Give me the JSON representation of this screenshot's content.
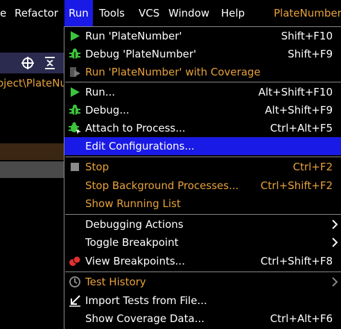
{
  "menubar": {
    "items": [
      {
        "label": "e",
        "active": false
      },
      {
        "label": "Refactor",
        "active": false
      },
      {
        "label": "Run",
        "active": true
      },
      {
        "label": "Tools",
        "active": false
      },
      {
        "label": "VCS",
        "active": false
      },
      {
        "label": "Window",
        "active": false
      },
      {
        "label": "Help",
        "active": false
      }
    ],
    "project_title": "PlateNumber"
  },
  "background": {
    "path_text": "oject\\PlateNu",
    "toolbar_icons": [
      "crosshair-icon",
      "collapse-all-icon"
    ]
  },
  "run_menu": {
    "items": [
      {
        "label": "Run 'PlateNumber'",
        "shortcut": "Shift+F10",
        "icon": "run-icon"
      },
      {
        "label": "Debug 'PlateNumber'",
        "shortcut": "Shift+F9",
        "icon": "debug-icon"
      },
      {
        "label": "Run 'PlateNumber' with Coverage",
        "shortcut": "",
        "icon": "coverage-icon",
        "disabled": true
      },
      {
        "label": "Run...",
        "shortcut": "Alt+Shift+F10",
        "icon": "run-icon"
      },
      {
        "label": "Debug...",
        "shortcut": "Alt+Shift+F9",
        "icon": "debug-icon"
      },
      {
        "label": "Attach to Process...",
        "shortcut": "Ctrl+Alt+F5",
        "icon": "attach-icon"
      },
      {
        "label": "Edit Configurations...",
        "shortcut": "",
        "icon": "",
        "selected": true
      },
      {
        "label": "Stop",
        "shortcut": "Ctrl+F2",
        "icon": "stop-icon",
        "disabled": true
      },
      {
        "label": "Stop Background Processes...",
        "shortcut": "Ctrl+Shift+F2",
        "icon": "",
        "disabled": true
      },
      {
        "label": "Show Running List",
        "shortcut": "",
        "icon": "",
        "disabled": true
      },
      {
        "label": "Debugging Actions",
        "shortcut": "",
        "icon": "",
        "submenu": true
      },
      {
        "label": "Toggle Breakpoint",
        "shortcut": "",
        "icon": "",
        "submenu": true
      },
      {
        "label": "View Breakpoints...",
        "shortcut": "Ctrl+Shift+F8",
        "icon": "breakpoints-icon"
      },
      {
        "label": "Test History",
        "shortcut": "",
        "icon": "history-icon",
        "disabled": true,
        "submenu": true
      },
      {
        "label": "Import Tests from File...",
        "shortcut": "",
        "icon": "import-icon"
      },
      {
        "label": "Show Coverage Data...",
        "shortcut": "Ctrl+Alt+F6",
        "icon": ""
      }
    ]
  },
  "colors": {
    "selection": "#1a1ae6",
    "disabled_text": "#e8a23a",
    "run_green": "#3cc43c",
    "breakpoint_red": "#e03030",
    "separator": "#8a8a8a"
  }
}
